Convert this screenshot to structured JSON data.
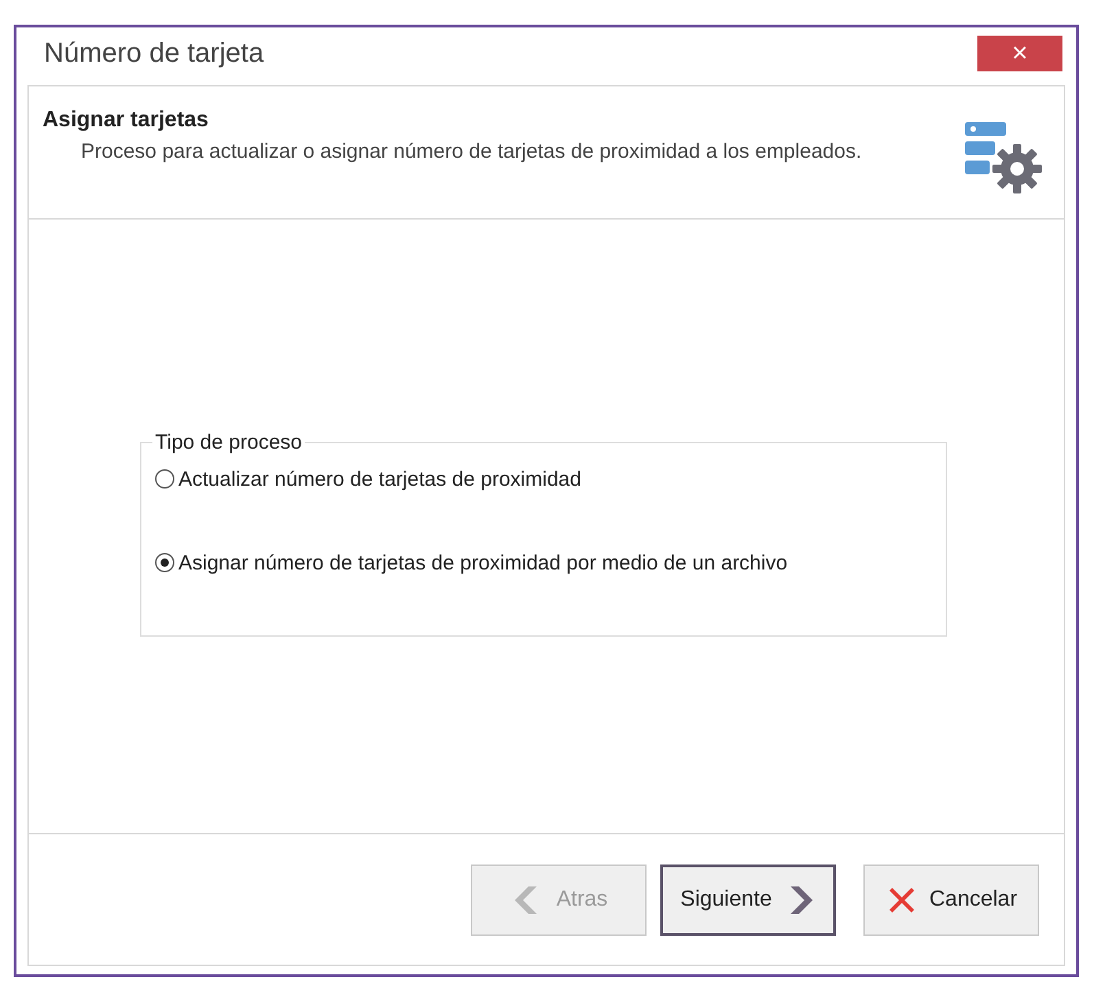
{
  "window": {
    "title": "Número de tarjeta",
    "close_label": "×"
  },
  "header": {
    "title": "Asignar tarjetas",
    "description": "Proceso para actualizar o asignar número de tarjetas de proximidad a los empleados."
  },
  "group": {
    "legend": "Tipo de proceso",
    "options": [
      {
        "label": "Actualizar número de tarjetas de proximidad",
        "selected": false
      },
      {
        "label": "Asignar número de tarjetas de proximidad por medio de un archivo",
        "selected": true
      }
    ]
  },
  "buttons": [
    {
      "kind": "back",
      "label": "Atras",
      "disabled": true,
      "default": false
    },
    {
      "kind": "next",
      "label": "Siguiente",
      "disabled": false,
      "default": true
    },
    {
      "kind": "cancel",
      "label": "Cancelar",
      "disabled": false,
      "default": false
    }
  ]
}
